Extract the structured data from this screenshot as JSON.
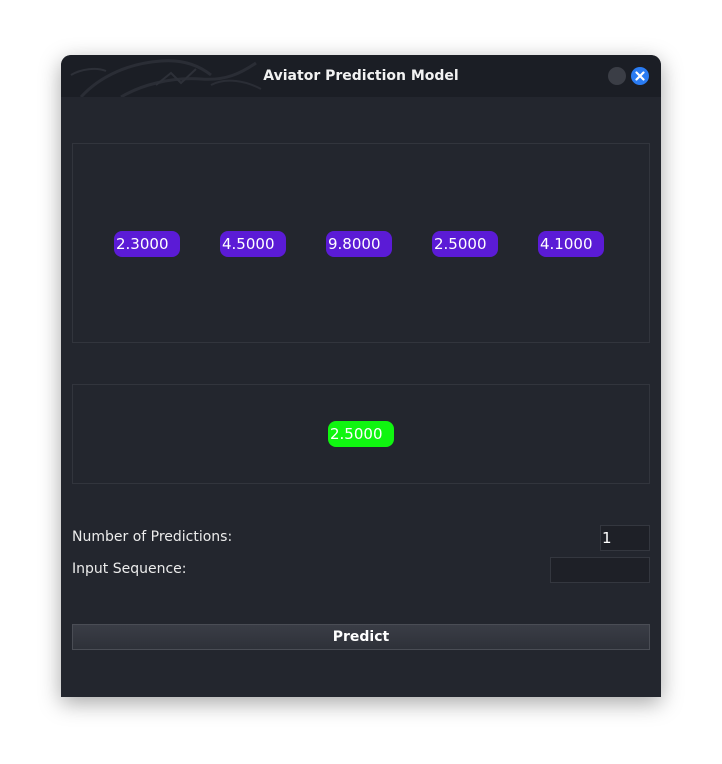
{
  "window": {
    "title": "Aviator Prediction Model"
  },
  "sequence_values": [
    "2.3000",
    "4.5000",
    "9.8000",
    "2.5000",
    "4.1000"
  ],
  "prediction_value": "2.5000",
  "form": {
    "num_predictions_label": "Number of Predictions:",
    "num_predictions_value": "1",
    "input_sequence_label": "Input Sequence:",
    "input_sequence_value": ""
  },
  "predict_button_label": "Predict",
  "colors": {
    "window_bg": "#23262e",
    "titlebar_bg": "#1b1e25",
    "sequence_pill": "#5b1bd6",
    "prediction_pill": "#10f510",
    "close_button": "#2a7cf3"
  },
  "icons": {
    "minimize": "minimize-icon",
    "close": "close-icon",
    "titlebar_decoration": "dragon-icon"
  }
}
